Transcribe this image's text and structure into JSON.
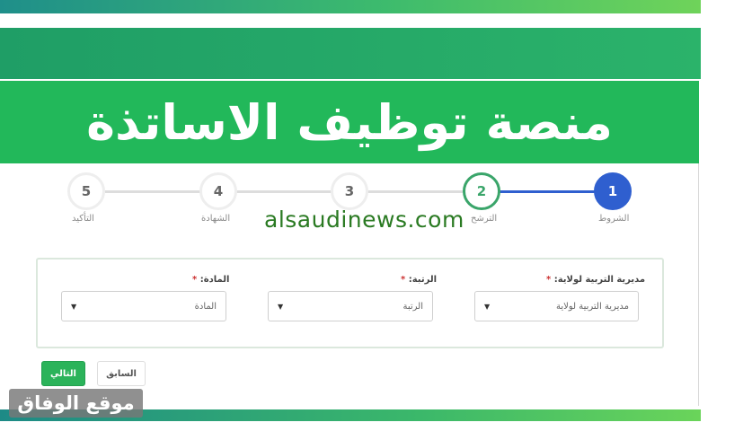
{
  "banner": {
    "title": "منصة توظيف الاساتذة"
  },
  "stepper": {
    "steps": [
      {
        "number": "1",
        "label": "الشروط",
        "state": "current"
      },
      {
        "number": "2",
        "label": "الترشح",
        "state": "active"
      },
      {
        "number": "3",
        "label": "",
        "state": "pending"
      },
      {
        "number": "4",
        "label": "الشهادة",
        "state": "pending"
      },
      {
        "number": "5",
        "label": "التأكيد",
        "state": "pending"
      }
    ]
  },
  "watermark": "alsaudinews.com",
  "form": {
    "directorate": {
      "label": "مديرية التربية لولاية:",
      "required": "*",
      "value": "مديرية التربية لولاية"
    },
    "rank": {
      "label": "الرتبة:",
      "required": "*",
      "value": "الرتبة"
    },
    "subject": {
      "label": "المادة:",
      "required": "*",
      "value": "المادة"
    }
  },
  "buttons": {
    "prev_label": "السابق",
    "next_label": "التالي"
  },
  "logo": {
    "text": "موقع الوفاق"
  },
  "colors": {
    "primary_green": "#22b85a",
    "step_blue": "#2f5fcf",
    "step_green": "#3aa56a"
  },
  "icons": {
    "select_arrow": "caret-down-icon"
  }
}
